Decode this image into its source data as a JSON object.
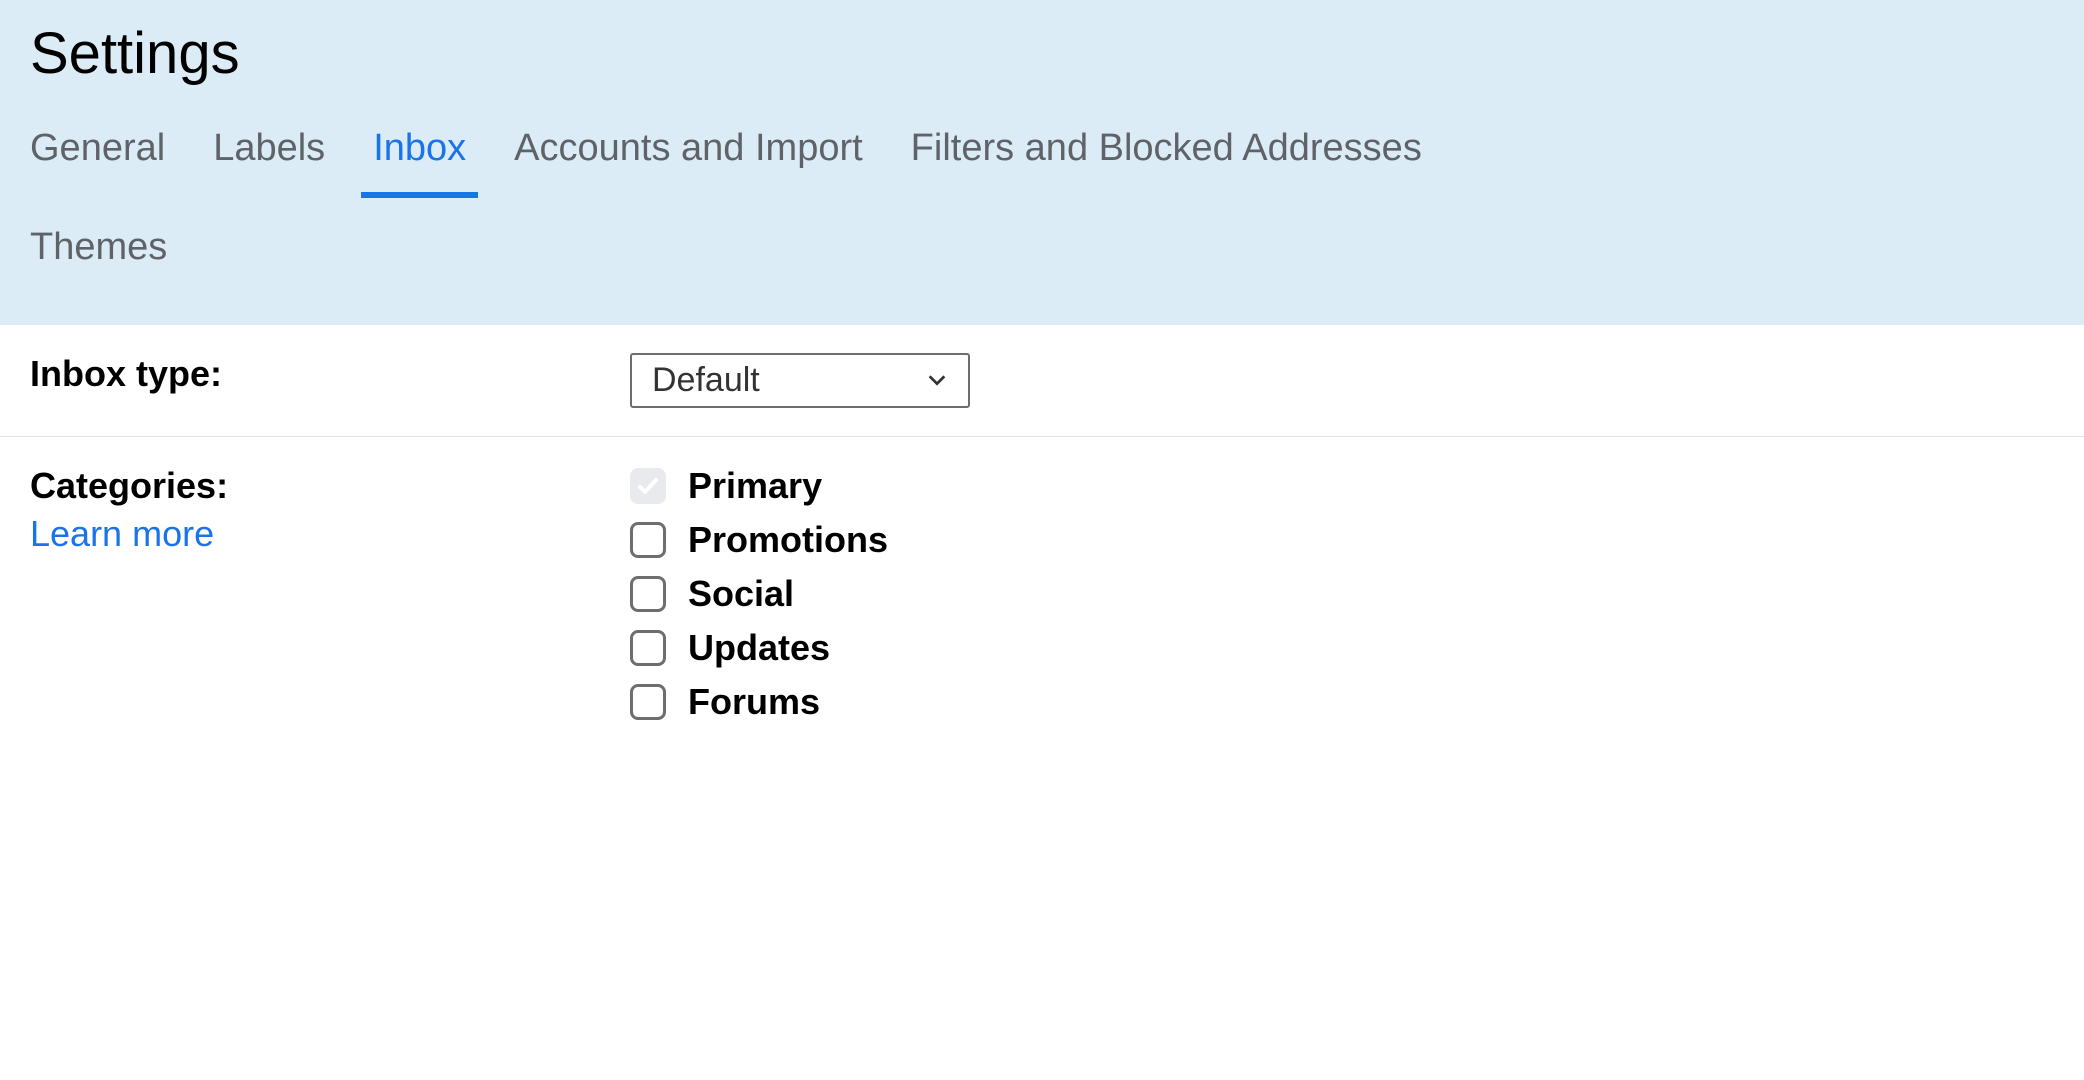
{
  "header": {
    "title": "Settings"
  },
  "tabs": [
    {
      "label": "General",
      "active": false
    },
    {
      "label": "Labels",
      "active": false
    },
    {
      "label": "Inbox",
      "active": true
    },
    {
      "label": "Accounts and Import",
      "active": false
    },
    {
      "label": "Filters and Blocked Addresses",
      "active": false
    },
    {
      "label": "Themes",
      "active": false
    }
  ],
  "inbox_type": {
    "label": "Inbox type:",
    "selected": "Default"
  },
  "categories": {
    "label": "Categories:",
    "learn_more": "Learn more",
    "items": [
      {
        "label": "Primary",
        "checked": true,
        "disabled": true
      },
      {
        "label": "Promotions",
        "checked": false,
        "disabled": false
      },
      {
        "label": "Social",
        "checked": false,
        "disabled": false
      },
      {
        "label": "Updates",
        "checked": false,
        "disabled": false
      },
      {
        "label": "Forums",
        "checked": false,
        "disabled": false
      }
    ]
  }
}
